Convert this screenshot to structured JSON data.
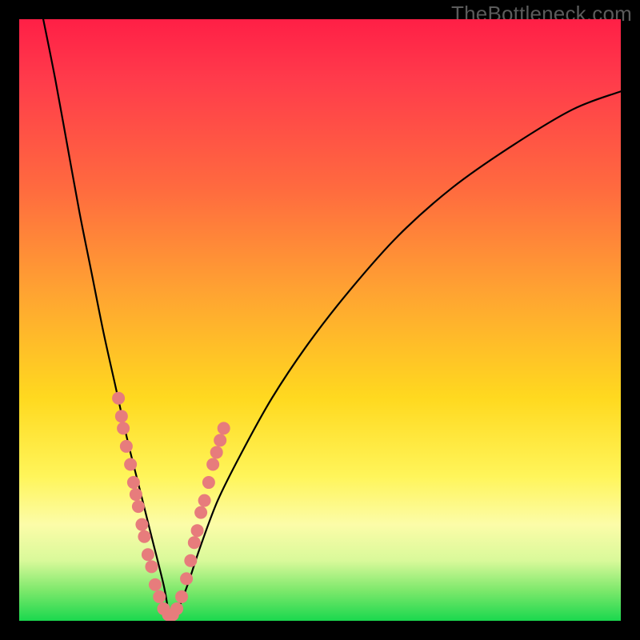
{
  "watermark": "TheBottleneck.com",
  "colors": {
    "background_frame": "#000000",
    "gradient": [
      "#ff1f46",
      "#ff3b4b",
      "#ff6a3f",
      "#ffa232",
      "#ffd91f",
      "#fff55a",
      "#fcfca8",
      "#d9f99a",
      "#7ce86b",
      "#1ad84e"
    ],
    "curve": "#000000",
    "points": "#e77c7c",
    "watermark_text": "#5b5b5b"
  },
  "chart_data": {
    "type": "line",
    "title": "",
    "xlabel": "",
    "ylabel": "",
    "xlim": [
      0,
      100
    ],
    "ylim": [
      0,
      100
    ],
    "grid": false,
    "legend": false,
    "note": "V-shaped bottleneck response curve. x is an unlabeled normalized axis (0–100 left→right). y is bottleneck severity (0 at bottom = optimal/green, 100 at top = worst/red). Curve minimum near x≈25 where y≈0. Scatter points cluster on both arms of the V near the minimum.",
    "series": [
      {
        "name": "bottleneck_curve",
        "x": [
          4,
          6,
          8,
          10,
          12,
          14,
          16,
          18,
          20,
          22,
          24,
          25,
          26,
          28,
          30,
          33,
          37,
          42,
          48,
          55,
          63,
          72,
          82,
          92,
          100
        ],
        "y": [
          100,
          90,
          79,
          68,
          58,
          48,
          39,
          30,
          22,
          14,
          6,
          1,
          1,
          6,
          12,
          20,
          28,
          37,
          46,
          55,
          64,
          72,
          79,
          85,
          88
        ]
      }
    ],
    "scatter_points": {
      "name": "sample_points",
      "xy": [
        [
          16.5,
          37
        ],
        [
          17.0,
          34
        ],
        [
          17.3,
          32
        ],
        [
          17.8,
          29
        ],
        [
          18.5,
          26
        ],
        [
          19.0,
          23
        ],
        [
          19.4,
          21
        ],
        [
          19.8,
          19
        ],
        [
          20.4,
          16
        ],
        [
          20.8,
          14
        ],
        [
          21.4,
          11
        ],
        [
          22.0,
          9
        ],
        [
          22.6,
          6
        ],
        [
          23.3,
          4
        ],
        [
          24.0,
          2
        ],
        [
          24.8,
          1
        ],
        [
          25.5,
          1
        ],
        [
          26.2,
          2
        ],
        [
          27.0,
          4
        ],
        [
          27.8,
          7
        ],
        [
          28.5,
          10
        ],
        [
          29.1,
          13
        ],
        [
          29.6,
          15
        ],
        [
          30.2,
          18
        ],
        [
          30.8,
          20
        ],
        [
          31.5,
          23
        ],
        [
          32.2,
          26
        ],
        [
          32.8,
          28
        ],
        [
          33.4,
          30
        ],
        [
          34.0,
          32
        ]
      ]
    }
  }
}
